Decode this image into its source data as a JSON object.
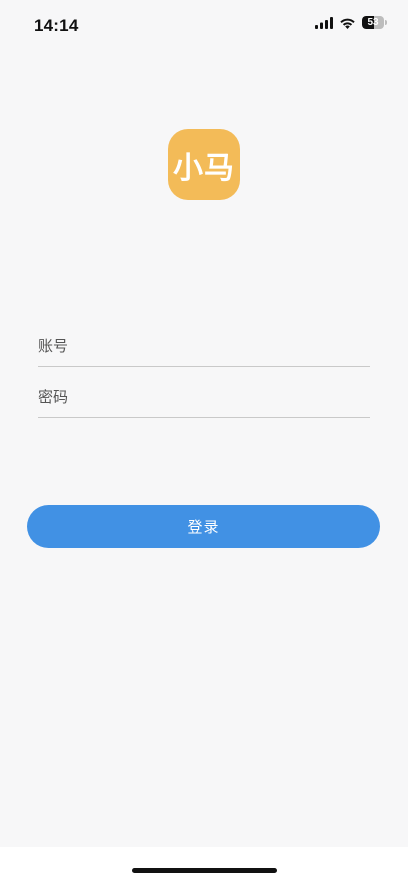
{
  "status_bar": {
    "time": "14:14",
    "battery_level": "53",
    "battery_fraction": 0.53,
    "signal_icon": "cellular-signal-icon",
    "wifi_icon": "wifi-icon",
    "battery_icon": "battery-icon"
  },
  "logo": {
    "text": "小马",
    "color": "#f3bb58"
  },
  "form": {
    "account_placeholder": "账号",
    "password_placeholder": "密码",
    "account_value": "",
    "password_value": ""
  },
  "login_button": {
    "label": "登录",
    "color": "#4191e4"
  }
}
